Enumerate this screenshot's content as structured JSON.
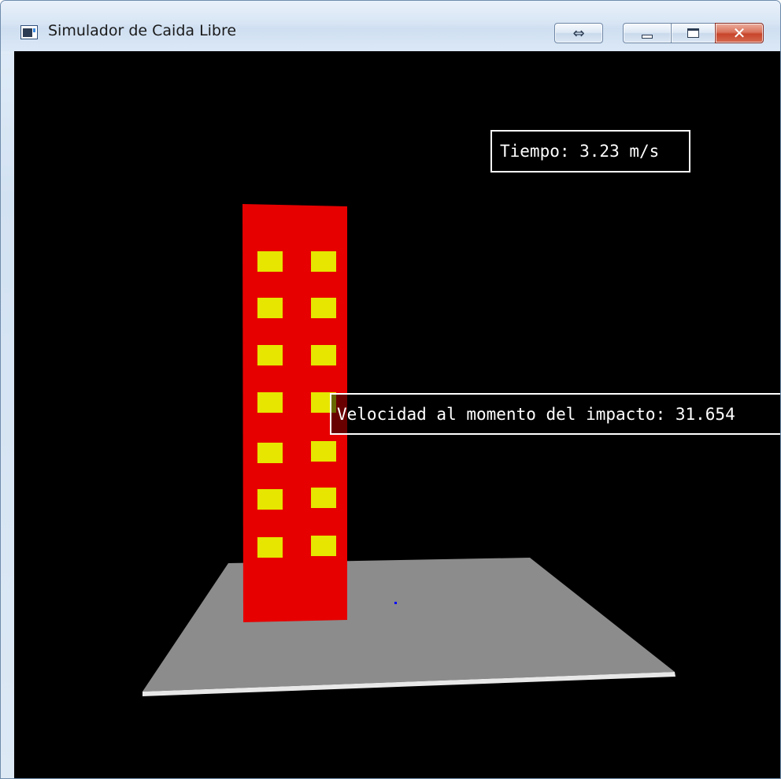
{
  "window": {
    "title": "Simulador de Caida Libre",
    "controls": {
      "swap_glyph": "⇔",
      "close_glyph": "✕"
    }
  },
  "hud": {
    "tiempo_label": "Tiempo: 3.23 m/s",
    "velocidad_label": "Velocidad al momento del impacto: 31.654"
  },
  "scene": {
    "background_color": "#000000",
    "building_color": "#e60000",
    "window_color": "#e6e600",
    "ground_color": "#8c8c8c",
    "ground_edge_color": "#e8e8e8",
    "falling_object_color": "#0000ff"
  }
}
